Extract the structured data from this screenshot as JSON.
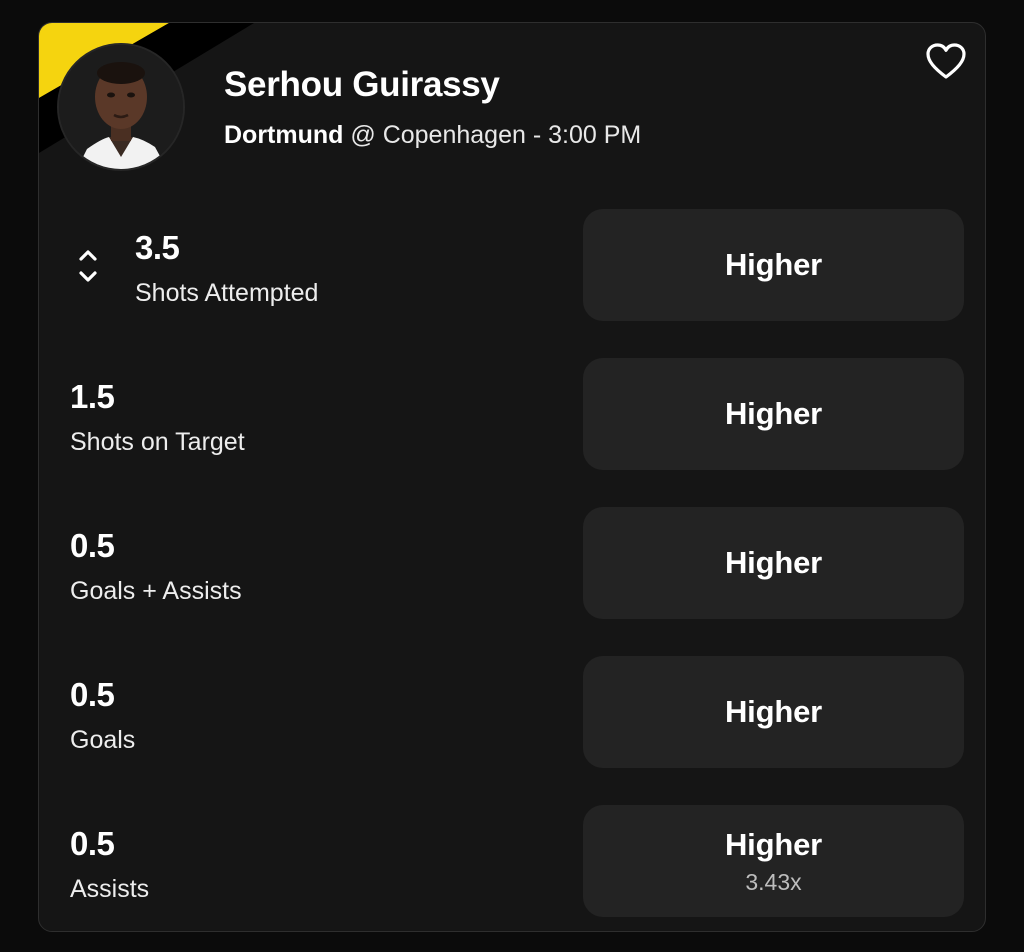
{
  "player": {
    "name": "Serhou Guirassy",
    "team": "Dortmund",
    "opponent_text": "@ Copenhagen - 3:00 PM"
  },
  "colors": {
    "accent_yellow": "#f5d40f",
    "card_bg": "#151515",
    "button_bg": "#232323"
  },
  "icons": {
    "favorite": "heart-outline-icon",
    "adjust": "chevron-up-down-icon"
  },
  "props": [
    {
      "value": "3.5",
      "label": "Shots Attempted",
      "pick": "Higher",
      "multiplier": ""
    },
    {
      "value": "1.5",
      "label": "Shots on Target",
      "pick": "Higher",
      "multiplier": ""
    },
    {
      "value": "0.5",
      "label": "Goals + Assists",
      "pick": "Higher",
      "multiplier": ""
    },
    {
      "value": "0.5",
      "label": "Goals",
      "pick": "Higher",
      "multiplier": ""
    },
    {
      "value": "0.5",
      "label": "Assists",
      "pick": "Higher",
      "multiplier": "3.43x"
    }
  ]
}
